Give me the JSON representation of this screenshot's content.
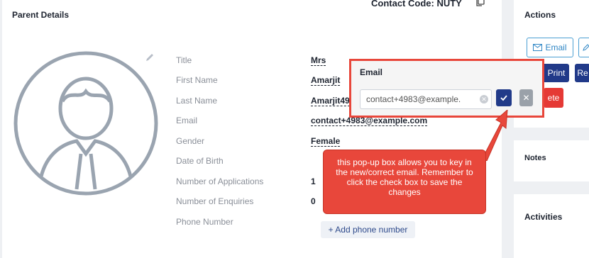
{
  "parent_details": {
    "title": "Parent Details",
    "contact_code_label": "Contact Code: NUTY",
    "fields": [
      {
        "label": "Title",
        "value": "Mrs"
      },
      {
        "label": "First Name",
        "value": "Amarjit"
      },
      {
        "label": "Last Name",
        "value": "Amarjit49"
      },
      {
        "label": "Email",
        "value": "contact+4983@example.com"
      },
      {
        "label": "Gender",
        "value": "Female"
      },
      {
        "label": "Date of Birth",
        "value": ""
      },
      {
        "label": "Number of Applications",
        "value": "1"
      },
      {
        "label": "Number of Enquiries",
        "value": "0"
      },
      {
        "label": "Phone Number",
        "value": ""
      }
    ],
    "add_phone_label": "+ Add phone number"
  },
  "actions": {
    "title": "Actions",
    "email_label": "Email",
    "print_label": "Print",
    "re_label": "Re",
    "delete_label": "ete"
  },
  "notes": {
    "title": "Notes"
  },
  "activities": {
    "title": "Activities"
  },
  "email_popup": {
    "title": "Email",
    "input_value": "contact+4983@example.",
    "cancel_glyph": "✕"
  },
  "callout": {
    "text": "this pop-up box allows you to key in the new/correct email. Remember to click the check box to save the changes"
  },
  "colors": {
    "primary": "#213a89",
    "danger": "#e53935",
    "callout": "#e8473b",
    "link_blue": "#2f86c5"
  }
}
